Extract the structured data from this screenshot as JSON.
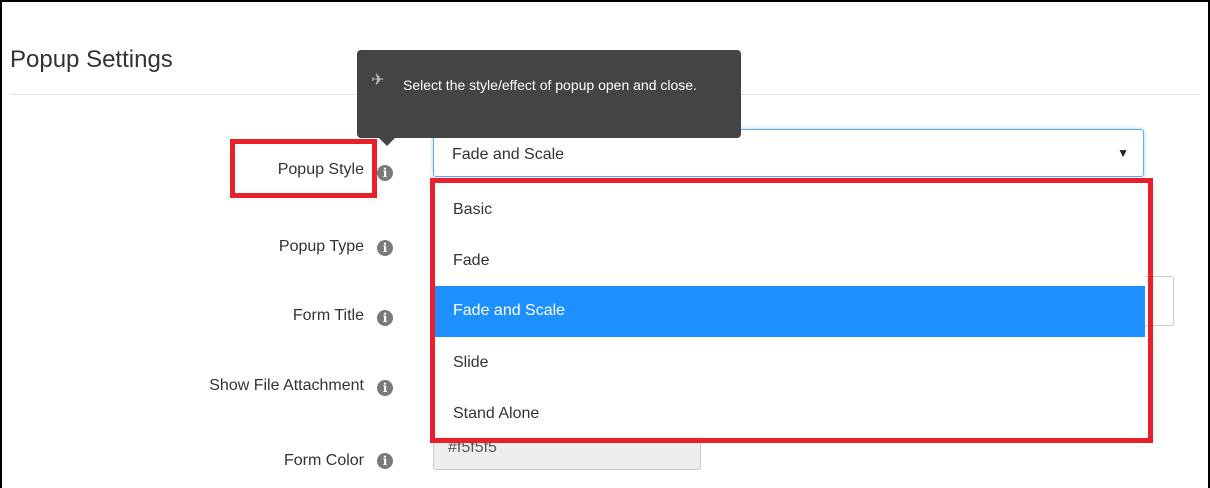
{
  "page": {
    "title": "Popup Settings"
  },
  "tooltip": {
    "icon": "pin-icon",
    "text": "Select the style/effect of popup open and close."
  },
  "fields": {
    "popup_style": {
      "label": "Popup Style",
      "info_icon": "info-icon"
    },
    "popup_type": {
      "label": "Popup Type",
      "info_icon": "info-icon"
    },
    "form_title": {
      "label": "Form Title",
      "info_icon": "info-icon"
    },
    "show_file_attachment": {
      "label": "Show File Attachment",
      "info_icon": "info-icon"
    },
    "form_color": {
      "label": "Form Color",
      "info_icon": "info-icon",
      "value": "#f5f5f5"
    }
  },
  "popup_style_select": {
    "selected": "Fade and Scale",
    "options": [
      {
        "label": "Basic"
      },
      {
        "label": "Fade"
      },
      {
        "label": "Fade and Scale",
        "selected": true
      },
      {
        "label": "Slide"
      },
      {
        "label": "Stand Alone"
      }
    ]
  },
  "colors": {
    "highlight": "#e8202a",
    "selected_option": "#1e90ff",
    "tooltip_bg": "#444444",
    "focus_border": "#66afe9"
  }
}
